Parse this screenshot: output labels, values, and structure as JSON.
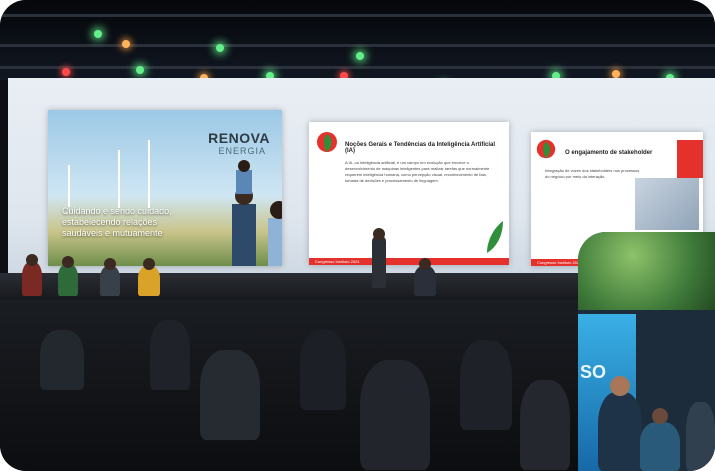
{
  "scene": {
    "description_kind": "conference stage photograph",
    "accent_red": "#e5312b",
    "stage_light_green": "#63f08a"
  },
  "slide_left": {
    "brand": "RENOVA",
    "brand_sub": "ENERGIA",
    "caption": "Cuidando e sendo cuidado, estabelecendo relações saudáveis e mutuamente"
  },
  "slide_center": {
    "title": "Noções Gerais e Tendências da Inteligência Artificial (IA)",
    "body": "A IA, ou inteligência artificial, é um campo em evolução que envolve o desenvolvimento de máquinas inteligentes para realizar tarefas que normalmente requerem inteligência humana, como percepção visual, reconhecimento de fala, tomada de decisões e processamento de linguagem.",
    "footer": "Congresso Instituto 2024"
  },
  "slide_right": {
    "title": "O engajamento de stakeholder",
    "body": "Integração de vozes dos stakeholders nos processos do negócio por meio da interação.",
    "footer": "Congresso Instituto 2024"
  },
  "booth": {
    "panel_text": "SO"
  }
}
